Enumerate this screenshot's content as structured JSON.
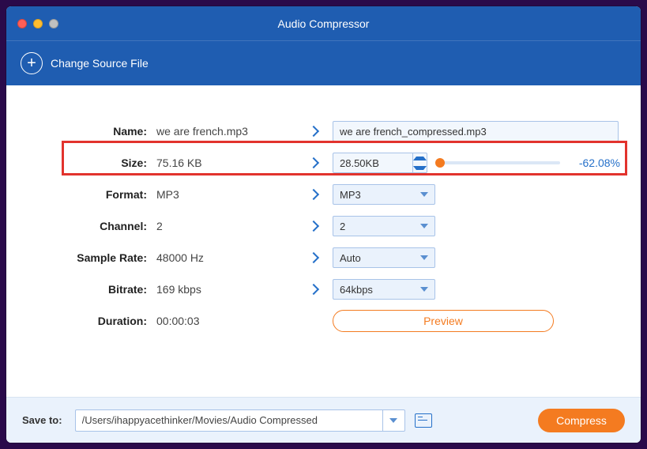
{
  "titlebar": {
    "title": "Audio Compressor"
  },
  "toolbar": {
    "change_source": "Change Source File"
  },
  "rows": {
    "name": {
      "label": "Name:",
      "orig": "we are french.mp3",
      "out": "we are french_compressed.mp3"
    },
    "size": {
      "label": "Size:",
      "orig": "75.16 KB",
      "out": "28.50KB",
      "pct": "-62.08%"
    },
    "format": {
      "label": "Format:",
      "orig": "MP3",
      "out": "MP3"
    },
    "channel": {
      "label": "Channel:",
      "orig": "2",
      "out": "2"
    },
    "sample": {
      "label": "Sample Rate:",
      "orig": "48000 Hz",
      "out": "Auto"
    },
    "bitrate": {
      "label": "Bitrate:",
      "orig": "169 kbps",
      "out": "64kbps"
    },
    "duration": {
      "label": "Duration:",
      "orig": "00:00:03"
    }
  },
  "preview_label": "Preview",
  "footer": {
    "saveto_label": "Save to:",
    "path": "/Users/ihappyacethinker/Movies/Audio Compressed",
    "compress_label": "Compress"
  }
}
